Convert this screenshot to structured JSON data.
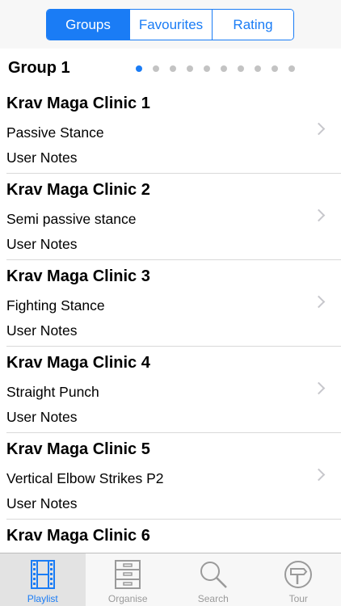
{
  "segments": [
    {
      "label": "Groups",
      "active": true
    },
    {
      "label": "Favourites",
      "active": false
    },
    {
      "label": "Rating",
      "active": false
    }
  ],
  "group": {
    "title": "Group 1",
    "page_count": 10,
    "current_page": 1
  },
  "items": [
    {
      "title": "Krav Maga Clinic 1",
      "subtitle": "Passive Stance",
      "notes": "User Notes"
    },
    {
      "title": "Krav Maga Clinic 2",
      "subtitle": "Semi passive stance",
      "notes": "User Notes"
    },
    {
      "title": "Krav Maga Clinic 3",
      "subtitle": "Fighting Stance",
      "notes": "User Notes"
    },
    {
      "title": "Krav Maga Clinic 4",
      "subtitle": "Straight Punch",
      "notes": "User Notes"
    },
    {
      "title": "Krav Maga Clinic 5",
      "subtitle": "Vertical Elbow Strikes P2",
      "notes": "User Notes"
    },
    {
      "title": "Krav Maga Clinic 6",
      "subtitle": "",
      "notes": ""
    }
  ],
  "tabs": [
    {
      "label": "Playlist",
      "icon": "film-strip-icon",
      "active": true
    },
    {
      "label": "Organise",
      "icon": "cabinet-icon",
      "active": false
    },
    {
      "label": "Search",
      "icon": "magnifier-icon",
      "active": false
    },
    {
      "label": "Tour",
      "icon": "signpost-icon",
      "active": false
    }
  ],
  "colors": {
    "accent": "#1a7cf5",
    "inactive": "#9a9a9a"
  }
}
